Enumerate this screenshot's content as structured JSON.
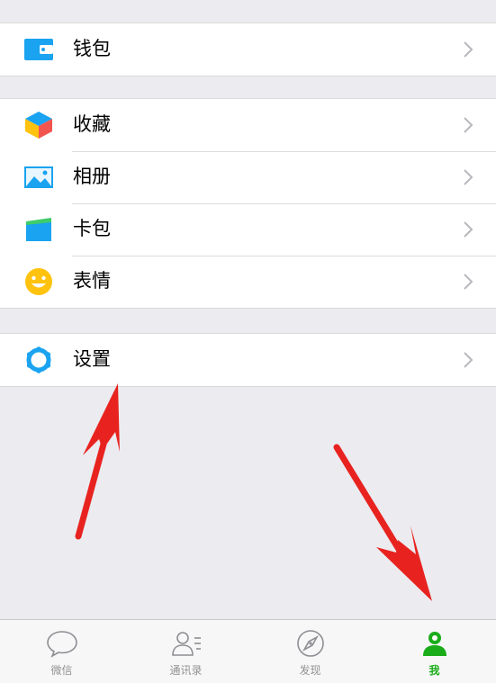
{
  "menu": {
    "group1": [
      {
        "label": "钱包",
        "icon": "wallet-icon"
      }
    ],
    "group2": [
      {
        "label": "收藏",
        "icon": "favorites-cube-icon"
      },
      {
        "label": "相册",
        "icon": "album-picture-icon"
      },
      {
        "label": "卡包",
        "icon": "card-package-icon"
      },
      {
        "label": "表情",
        "icon": "smiley-icon"
      }
    ],
    "group3": [
      {
        "label": "设置",
        "icon": "settings-gear-icon"
      }
    ]
  },
  "tabbar": {
    "tabs": [
      {
        "label": "微信",
        "icon": "chat-bubble-icon",
        "active": false
      },
      {
        "label": "通讯录",
        "icon": "contacts-icon",
        "active": false
      },
      {
        "label": "发现",
        "icon": "compass-icon",
        "active": false
      },
      {
        "label": "我",
        "icon": "me-person-icon",
        "active": true
      }
    ]
  },
  "colors": {
    "accent_green": "#1aad19",
    "icon_blue": "#1296db",
    "annotation_red": "#e8231f",
    "background": "#ebebf0"
  }
}
